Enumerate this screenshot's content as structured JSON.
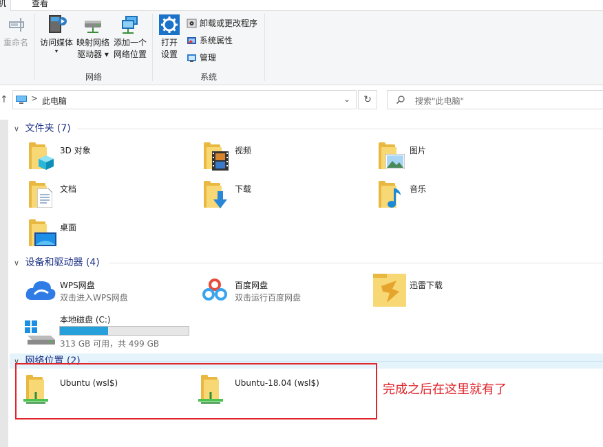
{
  "ribbon": {
    "tabs": [
      "计算机",
      "查看"
    ],
    "visible_tab_fragment": "机",
    "groups": {
      "location": {
        "rename_label": "重命名"
      },
      "network": {
        "label": "网络",
        "access_media_label": "访问媒体",
        "map_drive_line1": "映射网络",
        "map_drive_line2": "驱动器",
        "add_location_line1": "添加一个",
        "add_location_line2": "网络位置"
      },
      "system": {
        "label": "系统",
        "open_settings_line1": "打开",
        "open_settings_line2": "设置",
        "uninstall_label": "卸载或更改程序",
        "system_properties_label": "系统属性",
        "manage_label": "管理"
      }
    }
  },
  "address": {
    "separator": ">",
    "path": "此电脑",
    "dropdown": "⌄",
    "refresh": "↻"
  },
  "search": {
    "placeholder": "搜索\"此电脑\""
  },
  "sections": {
    "folders": {
      "title": "文件夹 (7)",
      "items": [
        {
          "name": "3D 对象",
          "icon": "3d-objects-folder-icon"
        },
        {
          "name": "视频",
          "icon": "videos-folder-icon"
        },
        {
          "name": "图片",
          "icon": "pictures-folder-icon"
        },
        {
          "name": "文档",
          "icon": "documents-folder-icon"
        },
        {
          "name": "下载",
          "icon": "downloads-folder-icon"
        },
        {
          "name": "音乐",
          "icon": "music-folder-icon"
        },
        {
          "name": "桌面",
          "icon": "desktop-folder-icon"
        }
      ]
    },
    "devices": {
      "title": "设备和驱动器 (4)",
      "items": [
        {
          "name": "WPS网盘",
          "sub": "双击进入WPS网盘",
          "icon": "wps-cloud-icon"
        },
        {
          "name": "百度网盘",
          "sub": "双击运行百度网盘",
          "icon": "baidu-netdisk-icon"
        },
        {
          "name": "迅雷下载",
          "icon": "thunder-download-icon"
        },
        {
          "name": "本地磁盘 (C:)",
          "sub": "313 GB 可用，共 499 GB",
          "icon": "local-disk-icon",
          "used_fraction": 0.373
        }
      ]
    },
    "network": {
      "title": "网络位置 (2)",
      "items": [
        {
          "name": "Ubuntu (wsl$)",
          "icon": "network-folder-icon"
        },
        {
          "name": "Ubuntu-18.04 (wsl$)",
          "icon": "network-folder-icon"
        }
      ]
    }
  },
  "annotation": {
    "text": "完成之后在这里就有了",
    "color": "#e0242c"
  },
  "colors": {
    "section_title": "#1e3287",
    "disk_bar_fill": "#26a0da",
    "selection": "#e5f3fb"
  }
}
